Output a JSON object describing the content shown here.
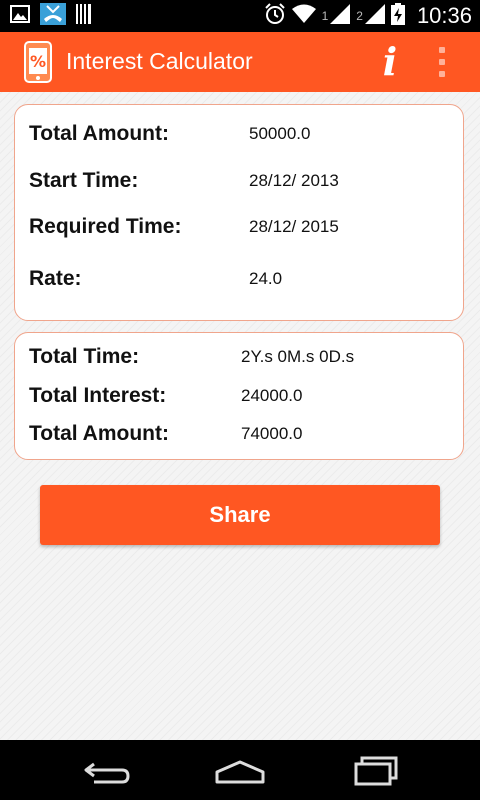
{
  "status_bar": {
    "time": "10:36",
    "sim1": "1",
    "sim2": "2",
    "icons": [
      "image-icon",
      "call-missed-icon",
      "barcode-icon",
      "alarm-icon",
      "wifi-icon",
      "signal-icon",
      "signal-icon",
      "battery-charging-icon"
    ]
  },
  "action_bar": {
    "title": "Interest Calculator",
    "info_label": "i",
    "color": "#ff5722"
  },
  "input_card": {
    "rows": [
      {
        "label": "Total Amount:",
        "value": "50000.0"
      },
      {
        "label": "Start Time:",
        "value": "28/12/ 2013"
      },
      {
        "label": "Required Time:",
        "value": "28/12/ 2015"
      },
      {
        "label": "Rate:",
        "value": "24.0"
      }
    ]
  },
  "result_card": {
    "rows": [
      {
        "label": "Total Time:",
        "value": "2Y.s 0M.s 0D.s"
      },
      {
        "label": "Total Interest:",
        "value": "24000.0"
      },
      {
        "label": "Total Amount:",
        "value": "74000.0"
      }
    ]
  },
  "share_button": {
    "label": "Share"
  },
  "nav_bar": {
    "icons": [
      "back-icon",
      "home-icon",
      "recents-icon"
    ]
  }
}
